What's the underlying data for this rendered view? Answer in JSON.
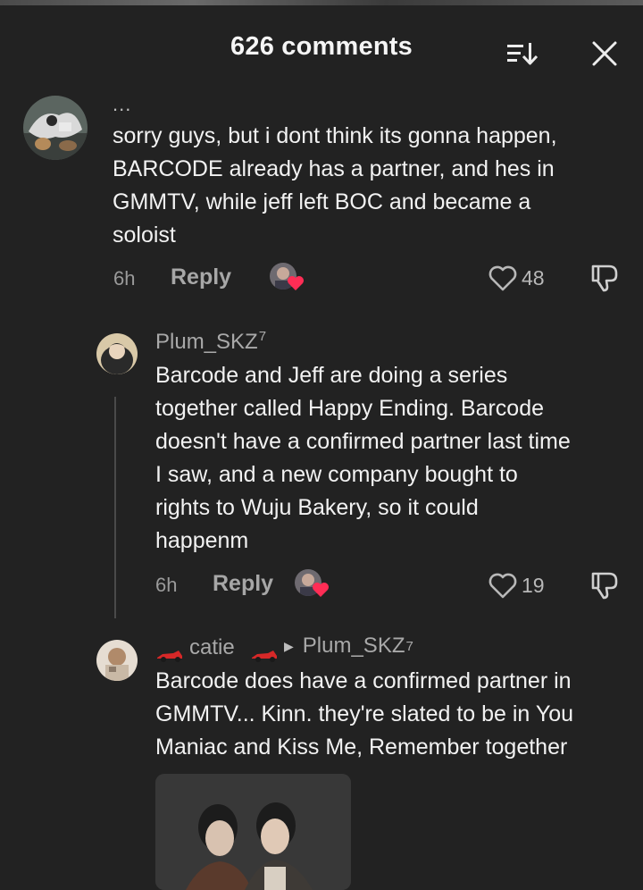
{
  "header": {
    "title": "626 comments",
    "sort_icon": "sort-icon",
    "close_icon": "close-icon"
  },
  "comments": [
    {
      "more": "...",
      "text_lines": [
        "sorry guys, but i dont think its gonna happen,",
        "BARCODE already has a partner, and hes in",
        "GMMTV, while jeff left BOC and became a",
        "soloist"
      ],
      "time": "6h",
      "reply_label": "Reply",
      "likes": "48",
      "creator_liked_icon": "creator-liked-avatar-icon"
    },
    {
      "username": "Plum_SKZ",
      "username_sup": "7",
      "text_lines": [
        "Barcode and Jeff are doing a series",
        "together called Happy Ending. Barcode",
        "doesn't have a confirmed partner last time",
        "I saw, and a new company bought to",
        "rights to Wuju Bakery, so it could",
        "happenm"
      ],
      "time": "6h",
      "reply_label": "Reply",
      "likes": "19",
      "creator_liked_icon": "creator-liked-avatar-icon"
    },
    {
      "username": "catie",
      "reply_to": "Plum_SKZ",
      "reply_to_sup": "7",
      "text_lines": [
        "Barcode does have a confirmed partner in",
        "GMMTV... Kinn. they're slated to be in You",
        "Maniac and Kiss Me, Remember together"
      ]
    }
  ],
  "colors": {
    "background": "#222222",
    "text": "#f2f2f2",
    "muted": "#a9a9a9",
    "heart_accent": "#ff2d55"
  }
}
